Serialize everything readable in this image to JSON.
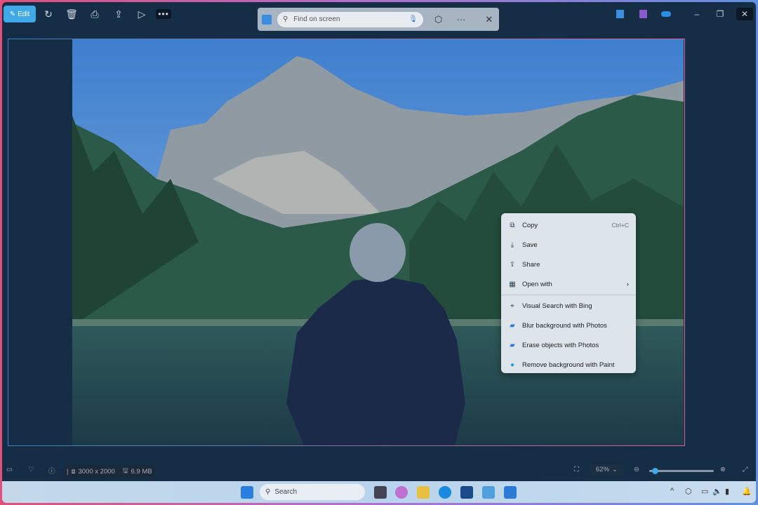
{
  "toolbar": {
    "edit_label": "Edit",
    "icons": [
      "rotate-icon",
      "delete-icon",
      "print-icon",
      "share-icon",
      "slideshow-icon",
      "more-icon"
    ],
    "more_label": "•••"
  },
  "find_bar": {
    "placeholder": "Find on screen",
    "more_label": "···",
    "close_label": "✕"
  },
  "window_controls": {
    "minimize": "–",
    "restore": "❐",
    "close": "✕"
  },
  "context_menu": {
    "items": [
      {
        "label": "Copy",
        "shortcut": "Ctrl+C",
        "icon": "copy-icon"
      },
      {
        "label": "Save",
        "icon": "save-icon"
      },
      {
        "label": "Share",
        "icon": "share-icon"
      },
      {
        "label": "Open with",
        "icon": "open-with-icon",
        "submenu": true
      },
      {
        "label": "Visual Search with Bing",
        "icon": "visual-search-icon"
      },
      {
        "label": "Blur background with Photos",
        "icon": "photos-icon"
      },
      {
        "label": "Erase objects with Photos",
        "icon": "photos-icon"
      },
      {
        "label": "Remove background with Paint",
        "icon": "paint-icon"
      }
    ]
  },
  "status": {
    "dimensions": "3000 x 2000",
    "file_size": "6.9 MB",
    "zoom": "62%",
    "zoom_fraction": 0.05
  },
  "taskbar": {
    "search_label": "Search"
  },
  "colors": {
    "accent": "#3fa9e8",
    "window_bg": "#152d45"
  }
}
